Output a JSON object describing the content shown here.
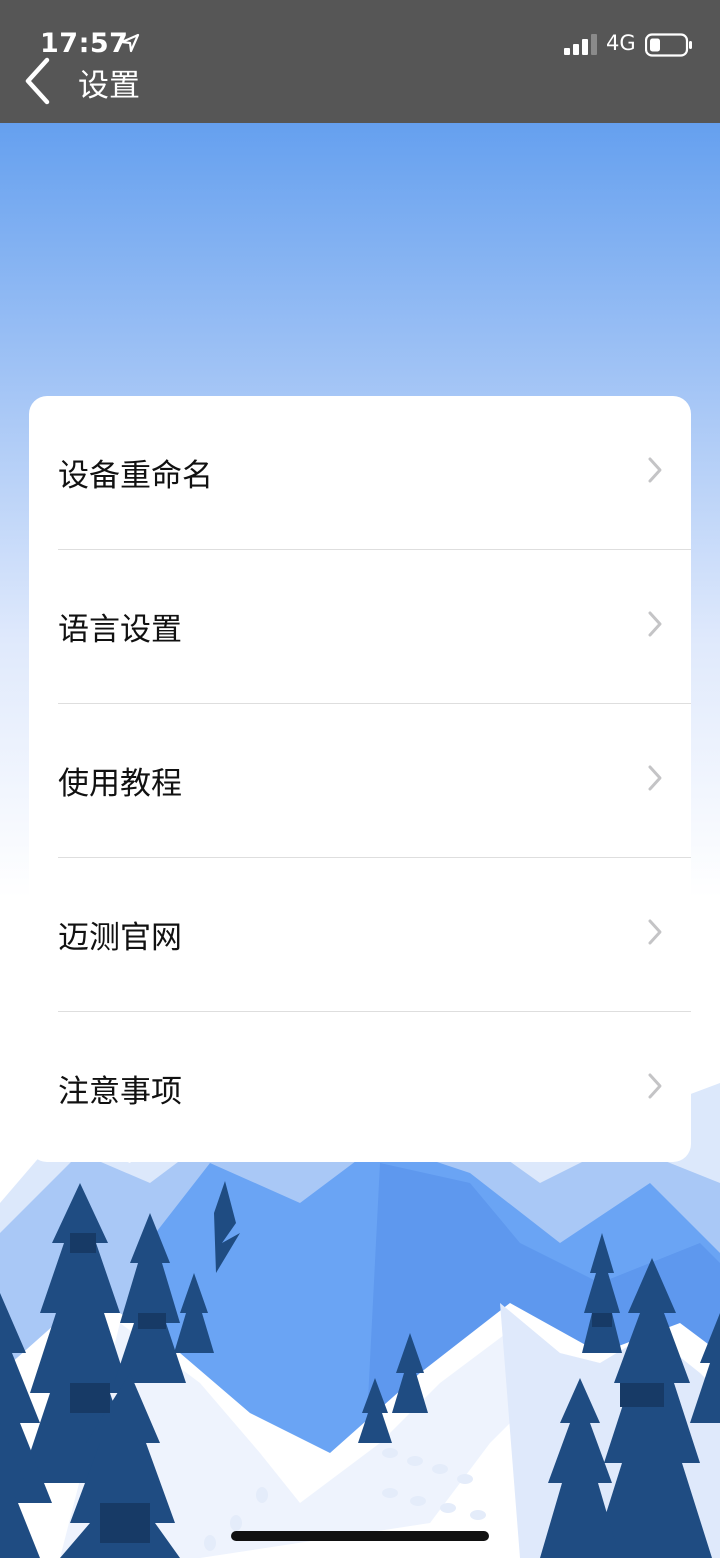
{
  "status_bar": {
    "time": "17:57",
    "network": "4G",
    "icons": [
      "location-arrow-icon",
      "signal-icon",
      "battery-icon"
    ]
  },
  "nav": {
    "back_icon": "chevron-left-icon",
    "title": "设置"
  },
  "settings": {
    "items": [
      {
        "label": "设备重命名",
        "icon": "chevron-right-icon"
      },
      {
        "label": "语言设置",
        "icon": "chevron-right-icon"
      },
      {
        "label": "使用教程",
        "icon": "chevron-right-icon"
      },
      {
        "label": "迈测官网",
        "icon": "chevron-right-icon"
      },
      {
        "label": "注意事项",
        "icon": "chevron-right-icon"
      }
    ]
  },
  "colors": {
    "header_bg": "#565656",
    "sky_top": "#65a0ef",
    "tree_dark": "#1f4c82",
    "mountain_blue": "#6aa4f4"
  }
}
